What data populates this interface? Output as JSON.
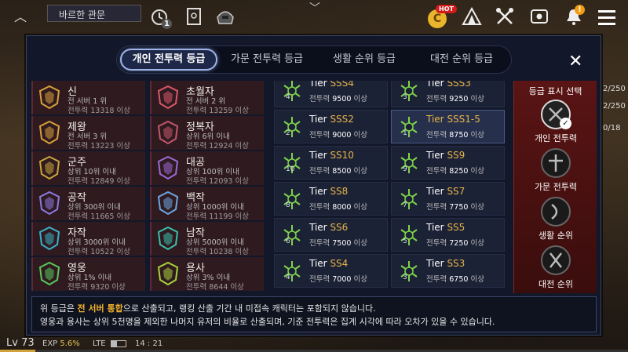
{
  "hud": {
    "title": "바르한 관문",
    "hot_label": "HOT",
    "coin_label": "C",
    "badge_one": "1",
    "badge_alert": "!"
  },
  "status": {
    "level": "Lv 73",
    "exp_label": "EXP",
    "exp_value": "5.6%",
    "exp_fraction": 0.056,
    "network": "LTE",
    "battery_fraction": 0.4,
    "time": "14 : 21"
  },
  "side_right": {
    "a": "2/250",
    "b": "2/250",
    "c": "0/18"
  },
  "modal": {
    "tabs": [
      "개인 전투력 등급",
      "가문 전투력 등급",
      "생활 순위 등급",
      "대전 순위 등급"
    ],
    "active_tab": 0,
    "close_label": "✕",
    "left_ranks": [
      {
        "name": "신",
        "line1": "전 서버 1 위",
        "line2": "전투력 13318 이상",
        "color": "#d9a03a"
      },
      {
        "name": "초월자",
        "line1": "전 서버 2 위",
        "line2": "전투력 13259 이상",
        "color": "#d9576a"
      },
      {
        "name": "제왕",
        "line1": "전 서버 3 위",
        "line2": "전투력 13223 이상",
        "color": "#d9a03a"
      },
      {
        "name": "정복자",
        "line1": "상위 6위 이내",
        "line2": "전투력 12924 이상",
        "color": "#c4566a"
      },
      {
        "name": "군주",
        "line1": "상위 10위 이내",
        "line2": "전투력 12849 이상",
        "color": "#c9a43a"
      },
      {
        "name": "대공",
        "line1": "상위 100위 이내",
        "line2": "전투력 12093 이상",
        "color": "#9a6ad4"
      },
      {
        "name": "공작",
        "line1": "상위 300위 이내",
        "line2": "전투력 11665 이상",
        "color": "#8a7ae0"
      },
      {
        "name": "백작",
        "line1": "상위 1000위 이내",
        "line2": "전투력 11199 이상",
        "color": "#6ba6e0"
      },
      {
        "name": "자작",
        "line1": "상위 3000위 이내",
        "line2": "전투력 10522 이상",
        "color": "#3ab0c8"
      },
      {
        "name": "남작",
        "line1": "상위 5000위 이내",
        "line2": "전투력 10238 이상",
        "color": "#3ac0a8"
      },
      {
        "name": "영웅",
        "line1": "상위 1% 이내",
        "line2": "전투력 9320 이상",
        "color": "#5ac85a"
      },
      {
        "name": "용사",
        "line1": "상위 3% 이내",
        "line2": "전투력 8644 이상",
        "color": "#a8d23a"
      }
    ],
    "tiers": [
      {
        "prefix": "Tier ",
        "grade": "SSS4",
        "power": "9500",
        "num": "4"
      },
      {
        "prefix": "Tier ",
        "grade": "SSS3",
        "power": "9250",
        "num": "3"
      },
      {
        "prefix": "Tier ",
        "grade": "SSS2",
        "power": "9000",
        "num": "2"
      },
      {
        "prefix": "Tier ",
        "grade": "SSS1-5",
        "power": "8750",
        "num": "1",
        "selected": true
      },
      {
        "prefix": "Tier ",
        "grade": "SS10",
        "power": "8500",
        "num": "10"
      },
      {
        "prefix": "Tier ",
        "grade": "SS9",
        "power": "8250",
        "num": "9"
      },
      {
        "prefix": "Tier ",
        "grade": "SS8",
        "power": "8000",
        "num": "8"
      },
      {
        "prefix": "Tier ",
        "grade": "SS7",
        "power": "7750",
        "num": "7"
      },
      {
        "prefix": "Tier ",
        "grade": "SS6",
        "power": "7500",
        "num": "6"
      },
      {
        "prefix": "Tier ",
        "grade": "SS5",
        "power": "7250",
        "num": "5"
      },
      {
        "prefix": "Tier ",
        "grade": "SS4",
        "power": "7000",
        "num": "4"
      },
      {
        "prefix": "Tier ",
        "grade": "SS3",
        "power": "6750",
        "num": "3"
      }
    ],
    "power_label": "전투력",
    "power_suffix": "이상",
    "display_select": {
      "title": "등급 표시 선택",
      "options": [
        "개인 전투력",
        "가문 전투력",
        "생활 순위",
        "대전 순위"
      ],
      "active": 0
    },
    "notice": {
      "l1_pre": "위 등급은 ",
      "l1_hl": "전 서버 통합",
      "l1_post": "으로 산출되고, 랭킹 산출 기간 내 미접속 캐릭터는 포함되지 않습니다.",
      "l2": "영웅과 용사는 상위 5천명을 제외한 나머지 유저의 비율로 산출되며, 기준 전투력은 집계 시각에 따라 오차가 있을 수 있습니다."
    }
  },
  "colors": {
    "tier_green": "#7fd44a",
    "tier_gold": "#e7b448",
    "accent_red": "#5a1414"
  }
}
